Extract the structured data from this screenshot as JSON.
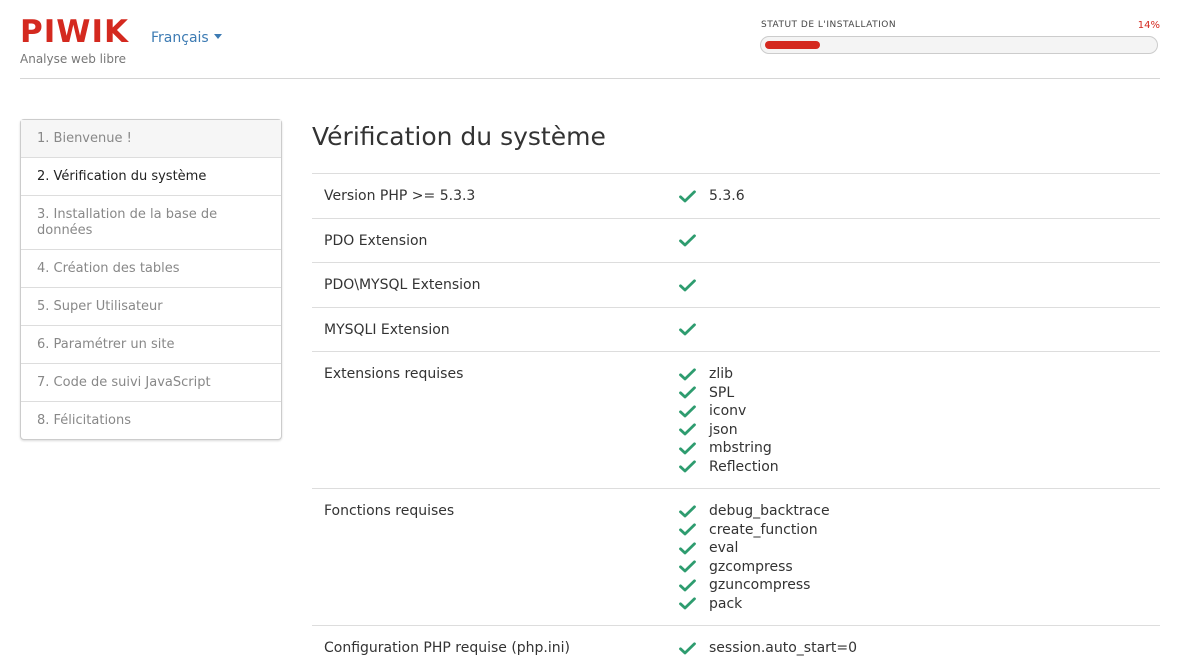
{
  "header": {
    "logo": "PIWIK",
    "tagline": "Analyse web libre",
    "language": "Français",
    "status_label": "STATUT DE L'INSTALLATION",
    "progress_percent_text": "14%",
    "progress_value": 14,
    "accent_color": "#d4291f",
    "link_color": "#3d7bb3",
    "check_color": "#2e9c6f"
  },
  "sidebar": {
    "steps": [
      {
        "label": "1. Bienvenue !"
      },
      {
        "label": "2. Vérification du système"
      },
      {
        "label": "3. Installation de la base de données"
      },
      {
        "label": "4. Création des tables"
      },
      {
        "label": "5. Super Utilisateur"
      },
      {
        "label": "6. Paramétrer un site"
      },
      {
        "label": "7. Code de suivi JavaScript"
      },
      {
        "label": "8. Félicitations"
      }
    ],
    "active_index": 1
  },
  "main": {
    "title": "Vérification du système",
    "checks": [
      {
        "requirement": "Version PHP >= 5.3.3",
        "results": [
          "5.3.6"
        ]
      },
      {
        "requirement": "PDO Extension",
        "results": [
          ""
        ]
      },
      {
        "requirement": "PDO\\MYSQL Extension",
        "results": [
          ""
        ]
      },
      {
        "requirement": "MYSQLI Extension",
        "results": [
          ""
        ]
      },
      {
        "requirement": "Extensions requises",
        "results": [
          "zlib",
          "SPL",
          "iconv",
          "json",
          "mbstring",
          "Reflection"
        ]
      },
      {
        "requirement": "Fonctions requises",
        "results": [
          "debug_backtrace",
          "create_function",
          "eval",
          "gzcompress",
          "gzuncompress",
          "pack"
        ]
      },
      {
        "requirement": "Configuration PHP requise (php.ini)",
        "results": [
          "session.auto_start=0"
        ]
      }
    ]
  },
  "icons": {
    "check": "check-icon",
    "caret": "chevron-down-icon"
  }
}
